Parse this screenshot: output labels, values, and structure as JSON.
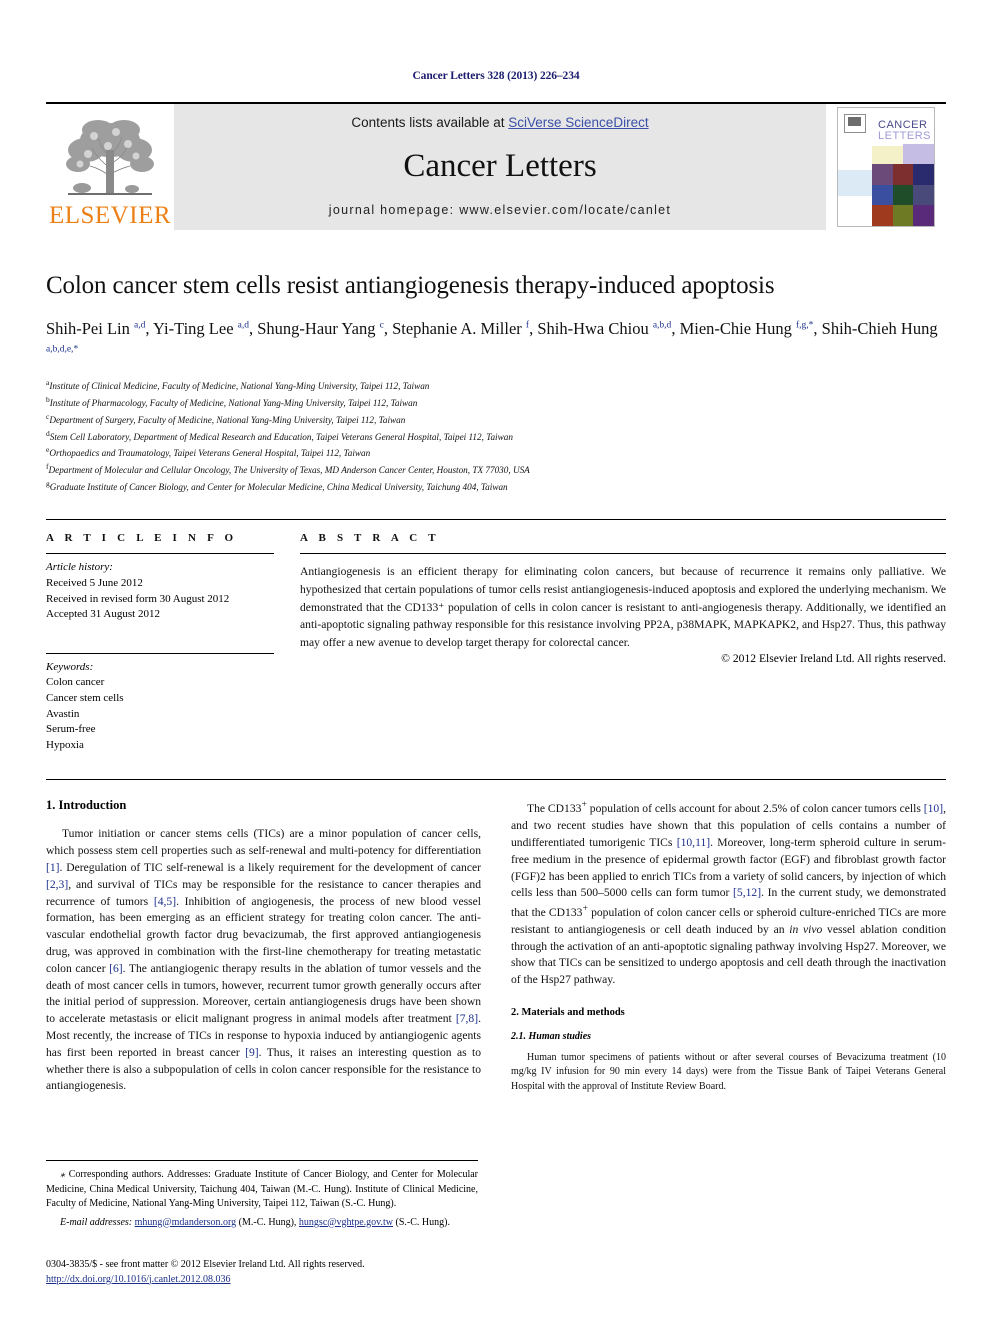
{
  "running_head": "Cancer Letters 328 (2013) 226–234",
  "masthead": {
    "publisher_name": "ELSEVIER",
    "contents_prefix": "Contents lists available at ",
    "contents_link": "SciVerse ScienceDirect",
    "journal_name": "Cancer Letters",
    "homepage": "journal homepage: www.elsevier.com/locate/canlet",
    "cover_title_line1": "CANCER",
    "cover_title_line2": "LETTERS"
  },
  "article": {
    "title": "Colon cancer stem cells resist antiangiogenesis therapy-induced apoptosis",
    "authors_html": "Shih-Pei Lin <sup>a,d</sup>, Yi-Ting Lee <sup>a,d</sup>, Shung-Haur Yang <sup>c</sup>, Stephanie A. Miller <sup>f</sup>, Shih-Hwa Chiou <sup>a,b,d</sup>, Mien-Chie Hung <sup>f,g,</sup><sup>*</sup>, Shih-Chieh Hung <sup>a,b,d,e,</sup><sup>*</sup>",
    "affiliations": [
      {
        "mark": "a",
        "text": "Institute of Clinical Medicine, Faculty of Medicine, National Yang-Ming University, Taipei 112, Taiwan"
      },
      {
        "mark": "b",
        "text": "Institute of Pharmacology, Faculty of Medicine, National Yang-Ming University, Taipei 112, Taiwan"
      },
      {
        "mark": "c",
        "text": "Department of Surgery, Faculty of Medicine, National Yang-Ming University, Taipei 112, Taiwan"
      },
      {
        "mark": "d",
        "text": "Stem Cell Laboratory, Department of Medical Research and Education, Taipei Veterans General Hospital, Taipei 112, Taiwan"
      },
      {
        "mark": "e",
        "text": "Orthopaedics and Traumatology, Taipei Veterans General Hospital, Taipei 112, Taiwan"
      },
      {
        "mark": "f",
        "text": "Department of Molecular and Cellular Oncology, The University of Texas, MD Anderson Cancer Center, Houston, TX 77030, USA"
      },
      {
        "mark": "g",
        "text": "Graduate Institute of Cancer Biology, and Center for Molecular Medicine, China Medical University, Taichung 404, Taiwan"
      }
    ]
  },
  "article_info": {
    "heading": "A R T I C L E    I N F O",
    "history_label": "Article history:",
    "history": [
      "Received 5 June 2012",
      "Received in revised form 30 August 2012",
      "Accepted 31 August 2012"
    ],
    "keywords_label": "Keywords:",
    "keywords": [
      "Colon cancer",
      "Cancer stem cells",
      "Avastin",
      "Serum-free",
      "Hypoxia"
    ]
  },
  "abstract": {
    "heading": "A B S T R A C T",
    "text": "Antiangiogenesis is an efficient therapy for eliminating colon cancers, but because of recurrence it remains only palliative. We hypothesized that certain populations of tumor cells resist antiangiogenesis-induced apoptosis and explored the underlying mechanism. We demonstrated that the CD133⁺ population of cells in colon cancer is resistant to anti-angiogenesis therapy. Additionally, we identified an anti-apoptotic signaling pathway responsible for this resistance involving PP2A, p38MAPK, MAPKAPK2, and Hsp27. Thus, this pathway may offer a new avenue to develop target therapy for colorectal cancer.",
    "copyright": "© 2012 Elsevier Ireland Ltd. All rights reserved."
  },
  "body": {
    "intro_heading": "1. Introduction",
    "intro_p1_html": "Tumor initiation or cancer stems cells (TICs) are a minor population of cancer cells, which possess stem cell properties such as self-renewal and multi-potency for differentiation <span class=\"ref\">[1]</span>. Deregulation of TIC self-renewal is a likely requirement for the development of cancer <span class=\"ref\">[2,3]</span>, and survival of TICs may be responsible for the resistance to cancer therapies and recurrence of tumors <span class=\"ref\">[4,5]</span>. Inhibition of angiogenesis, the process of new blood vessel formation, has been emerging as an efficient strategy for treating colon cancer. The anti-vascular endothelial growth factor drug bevacizumab, the first approved antiangiogenesis drug, was approved in combination with the first-line chemotherapy for treating metastatic colon cancer <span class=\"ref\">[6]</span>. The antiangiogenic therapy results in the ablation of tumor vessels and the death of most cancer cells in tumors, however, recurrent tumor growth generally occurs after the initial period of suppression. Moreover, certain antiangiogenesis drugs have been shown to accelerate metastasis or elicit malignant progress in animal models after treatment <span class=\"ref\">[7,8]</span>. Most recently, the increase of TICs in response to hypoxia induced by antiangiogenic agents has first been reported in breast cancer <span class=\"ref\">[9]</span>. Thus, it raises an interesting question as to whether there is also a subpopulation of cells in colon cancer responsible for the resistance to antiangiogenesis.",
    "intro_p2_html": "The CD133<sup>+</sup> population of cells account for about 2.5% of colon cancer tumors cells <span class=\"ref\">[10]</span>, and two recent studies have shown that this population of cells contains a number of undifferentiated tumorigenic TICs <span class=\"ref\">[10,11]</span>. Moreover, long-term spheroid culture in serum-free medium in the presence of epidermal growth factor (EGF) and fibroblast growth factor (FGF)2 has been applied to enrich TICs from a variety of solid cancers, by injection of which cells less than 500–5000 cells can form tumor <span class=\"ref\">[5,12]</span>. In the current study, we demonstrated that the CD133<sup>+</sup> population of colon cancer cells or spheroid culture-enriched TICs are more resistant to antiangiogenesis or cell death induced by an <i>in vivo</i> vessel ablation condition through the activation of an anti-apoptotic signaling pathway involving Hsp27. Moreover, we show that TICs can be sensitized to undergo apoptosis and cell death through the inactivation of the Hsp27 pathway.",
    "methods_heading": "2. Materials and methods",
    "methods_sub_heading": "2.1. Human studies",
    "methods_p1": "Human tumor specimens of patients without or after several courses of Bevacizuma treatment (10 mg/kg IV infusion for 90 min every 14 days) were from the Tissue Bank of Taipei Veterans General Hospital with the approval of Institute Review Board."
  },
  "footnote": {
    "corresponding_html": "<span class=\"em\">⁎</span> Corresponding authors. Addresses: Graduate Institute of Cancer Biology, and Center for Molecular Medicine, China Medical University, Taichung 404, Taiwan (M.-C. Hung). Institute of Clinical Medicine, Faculty of Medicine, National Yang-Ming University, Taipei 112, Taiwan (S.-C. Hung).",
    "email_label": "E-mail addresses:",
    "email_1": "mhung@mdanderson.org",
    "email_1_owner": "(M.-C. Hung),",
    "email_2": "hungsc@vghtpe.gov.tw",
    "email_2_owner": "(S.-C. Hung)."
  },
  "colophon": {
    "issn_line": "0304-3835/$ - see front matter © 2012 Elsevier Ireland Ltd. All rights reserved.",
    "doi": "http://dx.doi.org/10.1016/j.canlet.2012.08.036"
  },
  "colors": {
    "link_blue": "#1b2f8a",
    "sciencedirect_blue": "#3b4fa8",
    "elsevier_orange": "#ec8015",
    "banner_gray": "#e6e6e6"
  }
}
